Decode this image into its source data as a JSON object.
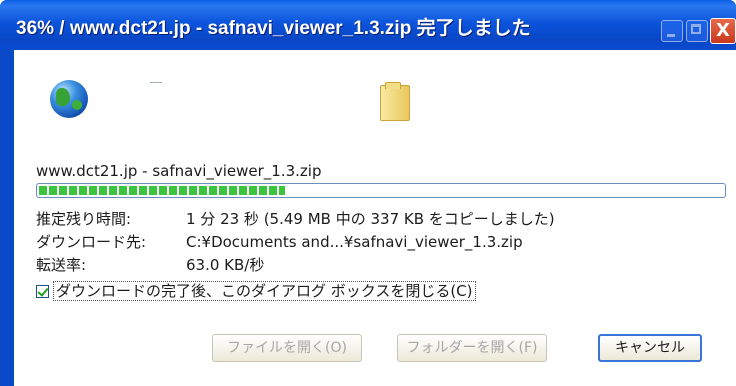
{
  "window": {
    "title": "36% / www.dct21.jp - safnavi_viewer_1.3.zip 完了しました",
    "close_glyph": "X"
  },
  "icons": {
    "globe": "globe-icon",
    "transfer": "paper-transfer-icon",
    "folder": "folder-icon"
  },
  "download": {
    "filename": "www.dct21.jp - safnavi_viewer_1.3.zip",
    "progress_percent": 36,
    "time_remaining_label": "推定残り時間:",
    "time_remaining_value": "1 分 23 秒 (5.49 MB 中の 337 KB をコピーしました)",
    "destination_label": "ダウンロード先:",
    "destination_value": "C:¥Documents and...¥safnavi_viewer_1.3.zip",
    "rate_label": "転送率:",
    "rate_value": "63.0 KB/秒"
  },
  "options": {
    "close_on_complete_label": "ダウンロードの完了後、このダイアログ ボックスを閉じる(C)",
    "close_on_complete_checked": true
  },
  "buttons": {
    "open_file": "ファイルを開く(O)",
    "open_folder": "フォルダーを開く(F)",
    "cancel": "キャンセル"
  },
  "colors": {
    "titlebar": "#0a54dc",
    "progress": "#3cc43c"
  }
}
